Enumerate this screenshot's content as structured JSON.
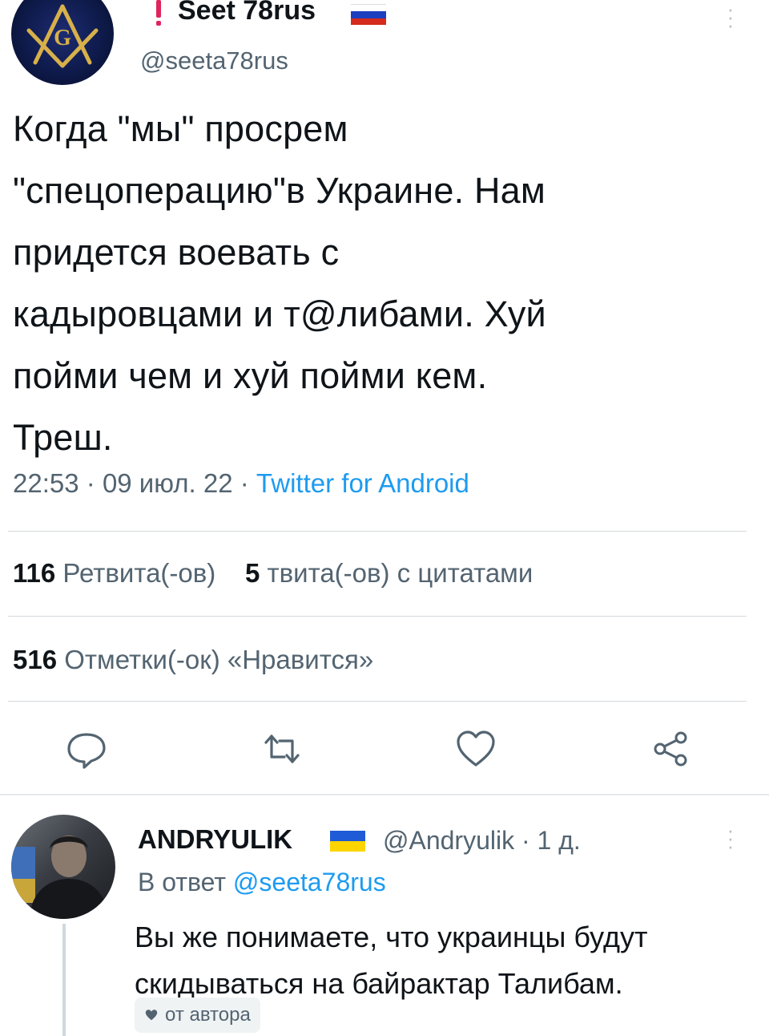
{
  "tweet": {
    "display_name": "Seet 78rus",
    "handle": "@seeta78rus",
    "text": "Когда \"мы\" просрем\n\"спецоперацию\"в Украине. Нам\nпридется воевать с\nкадыровцами и т@либами. Хуй\nпойми чем и хуй пойми кем.\nТреш.",
    "time": "22:53",
    "date": "09 июл. 22",
    "separator": "·",
    "source": "Twitter for Android",
    "flag_colors": [
      "#ffffff",
      "#1c3fbf",
      "#d52b1e"
    ],
    "stats": {
      "retweets_count": "116",
      "retweets_label": "Ретвита(-ов)",
      "quotes_count": "5",
      "quotes_label": "твита(-ов) с цитатами",
      "likes_count": "516",
      "likes_label": "Отметки(-ок) «Нравится»"
    },
    "actions": [
      "reply-icon",
      "retweet-icon",
      "like-icon",
      "share-icon"
    ]
  },
  "reply": {
    "display_name": "ANDRYULIK",
    "handle": "@Andryulik",
    "age": "1 д.",
    "separator": "·",
    "reply_prefix": "В ответ",
    "reply_to": "@seeta78rus",
    "text": "Вы же понимаете, что украинцы будут скидываться на байрактар Талибам.",
    "badge": "от автора",
    "flag_colors": [
      "#1f5bd6",
      "#ffd500"
    ]
  },
  "colors": {
    "accent": "#1d9bf0",
    "secondary_text": "#536471",
    "warning": "#e0245e"
  }
}
